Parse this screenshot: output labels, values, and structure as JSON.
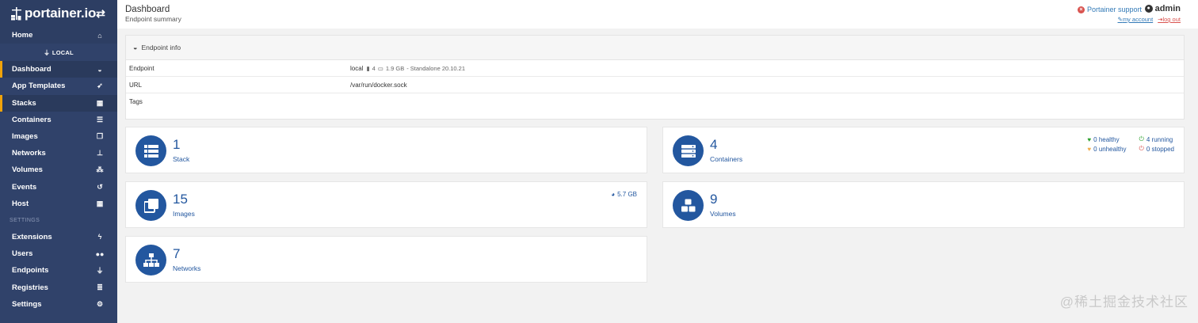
{
  "sidebar": {
    "brand": "portainer.io",
    "endpoint_title": "LOCAL",
    "settings_title": "SETTINGS",
    "items": [
      {
        "label": "Home",
        "icon": "home-icon"
      },
      {
        "label": "Dashboard",
        "icon": "tachometer-icon"
      },
      {
        "label": "App Templates",
        "icon": "rocket-icon"
      },
      {
        "label": "Stacks",
        "icon": "th-list-icon"
      },
      {
        "label": "Containers",
        "icon": "server-icon"
      },
      {
        "label": "Images",
        "icon": "clone-icon"
      },
      {
        "label": "Networks",
        "icon": "sitemap-icon"
      },
      {
        "label": "Volumes",
        "icon": "cubes-icon"
      },
      {
        "label": "Events",
        "icon": "history-icon"
      },
      {
        "label": "Host",
        "icon": "th-icon"
      },
      {
        "label": "Extensions",
        "icon": "bolt-icon"
      },
      {
        "label": "Users",
        "icon": "users-icon"
      },
      {
        "label": "Endpoints",
        "icon": "plug-icon"
      },
      {
        "label": "Registries",
        "icon": "database-icon"
      },
      {
        "label": "Settings",
        "icon": "cogs-icon"
      }
    ]
  },
  "header": {
    "title": "Dashboard",
    "subtitle": "Endpoint summary",
    "support": "Portainer support",
    "username": "admin",
    "my_account": "my account",
    "log_out": "log out"
  },
  "endpoint_info": {
    "title": "Endpoint info",
    "rows": [
      {
        "key": "Endpoint",
        "name": "local",
        "cpu": "4",
        "memory": "1.9 GB",
        "mode": "- Standalone 20.10.21"
      },
      {
        "key": "URL",
        "value": "/var/run/docker.sock"
      },
      {
        "key": "Tags",
        "value": ""
      }
    ]
  },
  "tiles": {
    "stack": {
      "count": "1",
      "label": "Stack"
    },
    "containers": {
      "count": "4",
      "label": "Containers",
      "healthy": "0 healthy",
      "running": "4 running",
      "unhealthy": "0 unhealthy",
      "stopped": "0 stopped"
    },
    "images": {
      "count": "15",
      "label": "Images",
      "size": "5.7 GB"
    },
    "volumes": {
      "count": "9",
      "label": "Volumes"
    },
    "networks": {
      "count": "7",
      "label": "Networks"
    }
  },
  "colors": {
    "sidebar_bg": "#30426a",
    "accent": "#23579f",
    "active_marker": "#f0a30a",
    "healthy": "#2ca02c",
    "unhealthy": "#f0ad4e",
    "stopped": "#d9534f"
  },
  "watermark": "@稀土掘金技术社区"
}
